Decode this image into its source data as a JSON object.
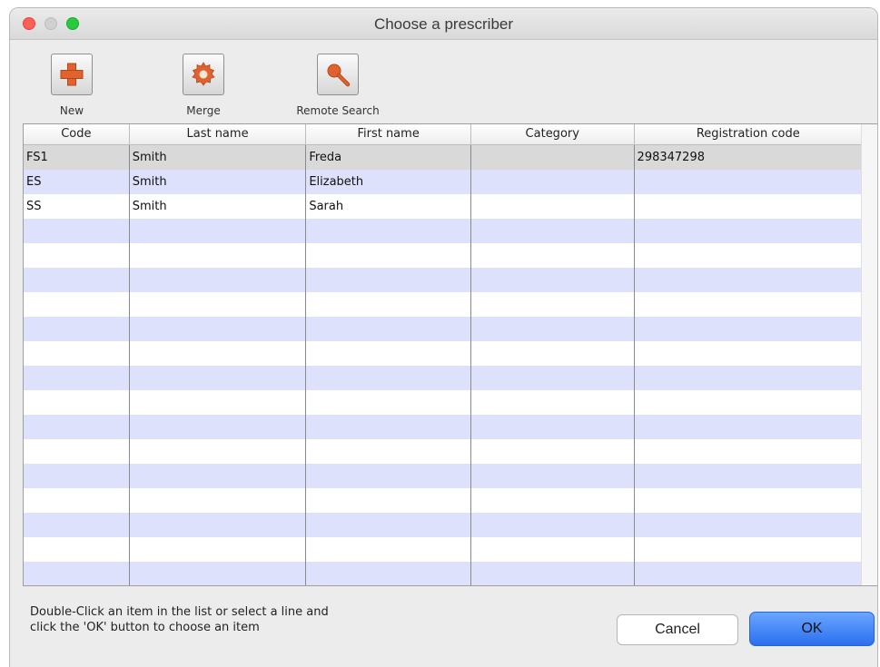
{
  "window": {
    "title": "Choose a prescriber"
  },
  "toolbar": {
    "new_label": "New",
    "merge_label": "Merge",
    "remote_search_label": "Remote Search"
  },
  "table": {
    "columns": [
      "Code",
      "Last name",
      "First name",
      "Category",
      "Registration code"
    ],
    "rows": [
      [
        "FS1",
        "Smith",
        "Freda",
        "",
        "298347298"
      ],
      [
        "ES",
        "Smith",
        "Elizabeth",
        "",
        ""
      ],
      [
        "SS",
        "Smith",
        "Sarah",
        "",
        ""
      ]
    ],
    "selected_row": 0,
    "stripe_color": "#dde1fb",
    "selected_color": "#d9d9d9"
  },
  "footer": {
    "hint_line1": "Double-Click an item in the list or select a line and",
    "hint_line2": "click the 'OK' button to choose an item",
    "cancel_label": "Cancel",
    "ok_label": "OK"
  },
  "colors": {
    "accent": "#2b6fef",
    "icon": "#e0622f"
  }
}
